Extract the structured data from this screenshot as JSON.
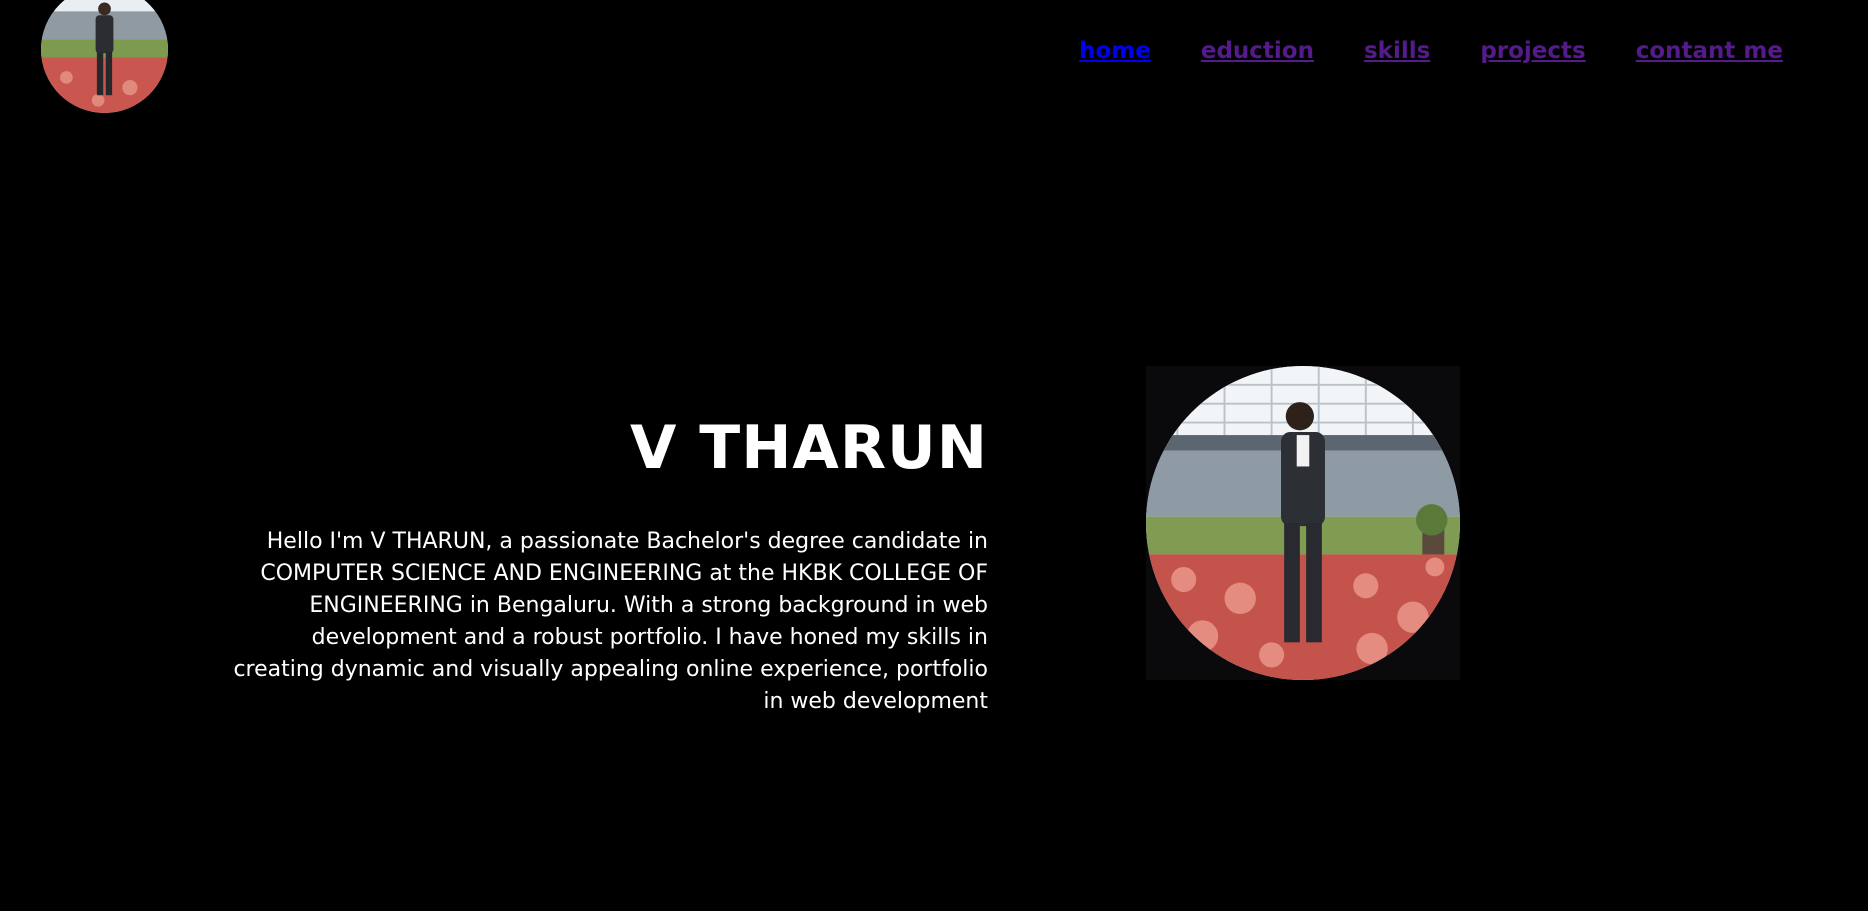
{
  "nav": {
    "items": [
      {
        "label": "home",
        "current": true
      },
      {
        "label": "eduction",
        "current": false
      },
      {
        "label": "skills",
        "current": false
      },
      {
        "label": "projects",
        "current": false
      },
      {
        "label": "contant me",
        "current": false
      }
    ]
  },
  "hero": {
    "name": "V THARUN",
    "bio": "Hello I'm V THARUN, a passionate Bachelor's degree candidate in COMPUTER SCIENCE AND ENGINEERING at the HKBK COLLEGE OF ENGINEERING in Bengaluru. With a strong background in web development and a robust portfolio. I have honed my skills in creating dynamic and visually appealing online experience, portfolio in web development"
  },
  "colors": {
    "background": "#000000",
    "text": "#ffffff",
    "link_current": "#0000ee",
    "link_visited": "#551a8b"
  }
}
